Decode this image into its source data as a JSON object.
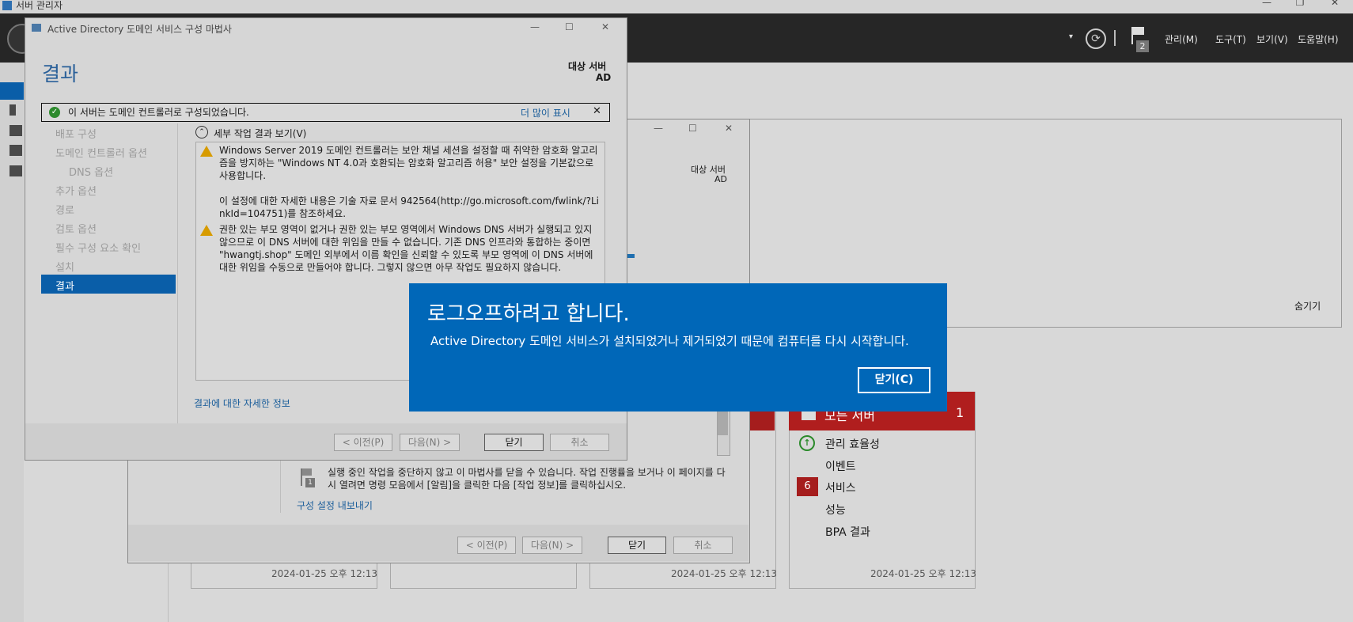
{
  "server_manager": {
    "title": "서버 관리자",
    "menus": [
      "관리(M)",
      "도구(T)",
      "보기(V)",
      "도움말(H)"
    ],
    "flag_count": "2",
    "hide_label": "숨기기",
    "tiles": {
      "all_servers_title": "모든 서버",
      "all_servers_count": "1",
      "items": [
        "관리 효율성",
        "이벤트",
        "서비스",
        "성능",
        "BPA 결과"
      ],
      "services_badge": "6",
      "timestamp": "2024-01-25 오후 12:13"
    }
  },
  "wizard": {
    "title": "Active Directory 도메인 서비스 구성 마법사",
    "heading": "결과",
    "target_label": "대상 서버",
    "target_value": "AD",
    "success_message": "이 서버는 도메인 컨트롤러로 구성되었습니다.",
    "more_link": "더 많이 표시",
    "nav": [
      "배포 구성",
      "도메인 컨트롤러 옵션",
      "DNS 옵션",
      "추가 옵션",
      "경로",
      "검토 옵션",
      "필수 구성 요소 확인",
      "설치",
      "결과"
    ],
    "details_toggle": "세부 작업 결과 보기(V)",
    "warning1": "Windows Server 2019 도메인 컨트롤러는 보안 채널 세션을 설정할 때 취약한 암호화 알고리즘을 방지하는 \"Windows NT 4.0과 호환되는 암호화 알고리즘 허용\" 보안 설정을 기본값으로 사용합니다.",
    "warning1_more": "이 설정에 대한 자세한 내용은 기술 자료 문서 942564(http://go.microsoft.com/fwlink/?LinkId=104751)를 참조하세요.",
    "warning2": "권한 있는 부모 영역이 없거나 권한 있는 부모 영역에서 Windows DNS 서버가 실행되고 있지 않으므로 이 DNS 서버에 대한 위임을 만들 수 없습니다. 기존 DNS 인프라와 통합하는 중이면 \"hwangtj.shop\" 도메인 외부에서 이름 확인을 신뢰할 수 있도록 부모 영역에 이 DNS 서버에 대한 위임을 수동으로 만들어야 합니다. 그렇지 않으면 아무 작업도 필요하지 않습니다.",
    "results_link": "결과에 대한 자세한 정보",
    "buttons": {
      "prev": "< 이전(P)",
      "next": "다음(N) >",
      "close": "닫기",
      "cancel": "취소"
    }
  },
  "wizard_background": {
    "target_label": "대상 서버",
    "target_value": "AD",
    "info_text": "실행 중인 작업을 중단하지 않고 이 마법사를 닫을 수 있습니다. 작업 진행률을 보거나 이 페이지를 다시 열려면 명령 모음에서 [알림]을 클릭한 다음 [작업 정보]를 클릭하십시오.",
    "export_link": "구성 설정 내보내기",
    "buttons": {
      "prev": "< 이전(P)",
      "next": "다음(N) >",
      "close": "닫기",
      "cancel": "취소"
    },
    "info_badge": "1"
  },
  "logoff_toast": {
    "title": "로그오프하려고 합니다.",
    "message": "Active Directory 도메인 서비스가 설치되었거나 제거되었기 때문에 컴퓨터를 다시 시작합니다.",
    "button": "닫기(C)"
  }
}
